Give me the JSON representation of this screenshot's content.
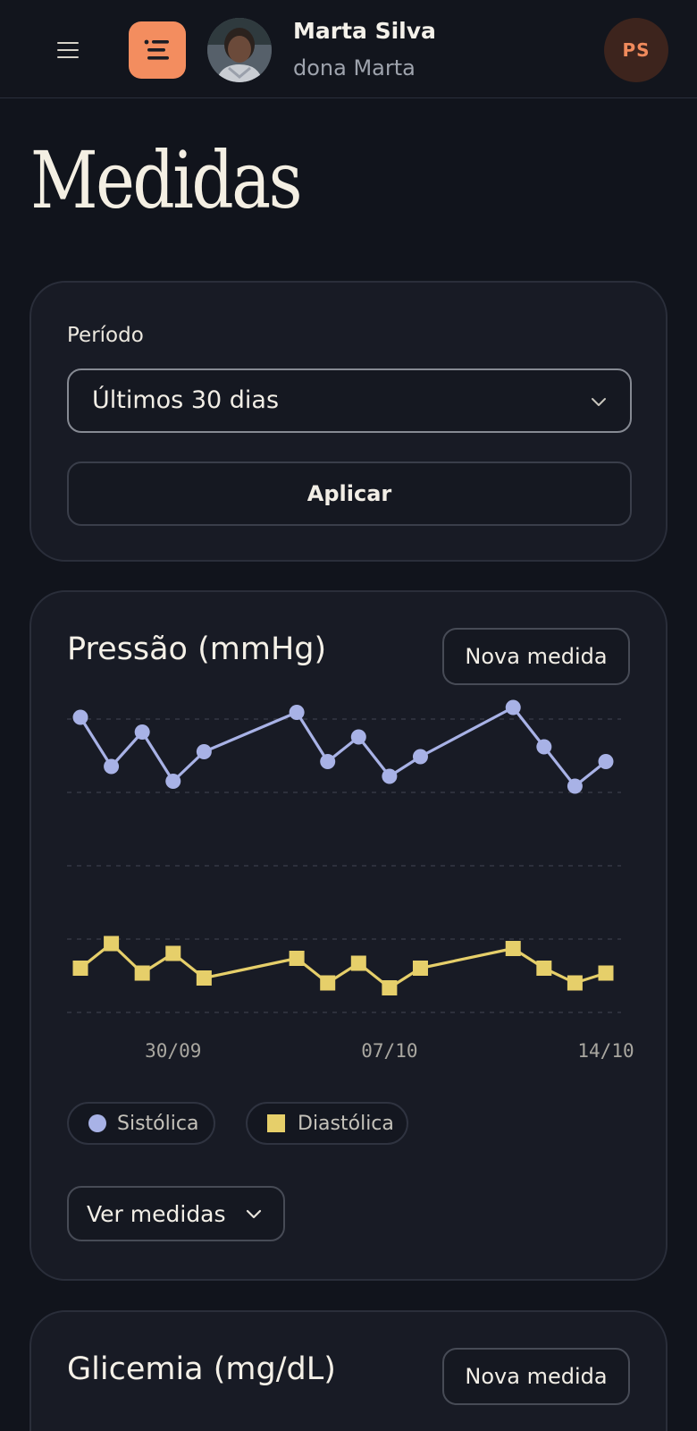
{
  "header": {
    "user_name": "Marta Silva",
    "user_nickname": "dona Marta",
    "initials": "PS",
    "accent": "#f38d5f"
  },
  "page": {
    "title": "Medidas"
  },
  "filter": {
    "label": "Período",
    "selected": "Últimos 30 dias",
    "apply_label": "Aplicar"
  },
  "pressure_card": {
    "title": "Pressão (mmHg)",
    "new_label": "Nova medida",
    "legend_systolic": "Sistólica",
    "legend_diastolic": "Diastólica",
    "view_label": "Ver medidas"
  },
  "glycemia_card": {
    "title": "Glicemia (mg/dL)",
    "new_label": "Nova medida"
  },
  "chart_data": {
    "type": "line",
    "x_tick_labels": [
      "30/09",
      "07/10",
      "14/10"
    ],
    "x": [
      "27/09",
      "28/09",
      "29/09",
      "30/09",
      "01/10",
      "04/10",
      "05/10",
      "06/10",
      "07/10",
      "08/10",
      "11/10",
      "12/10",
      "13/10",
      "14/10"
    ],
    "series": [
      {
        "name": "Sistólica",
        "color": "#a8b2e6",
        "marker": "circle",
        "values": [
          136,
          126,
          133,
          123,
          129,
          137,
          127,
          132,
          124,
          128,
          138,
          130,
          122,
          127
        ]
      },
      {
        "name": "Diastólica",
        "color": "#e6cf6a",
        "marker": "square",
        "values": [
          85,
          90,
          84,
          88,
          83,
          87,
          82,
          86,
          81,
          85,
          89,
          85,
          82,
          84
        ]
      }
    ],
    "grid": true
  }
}
